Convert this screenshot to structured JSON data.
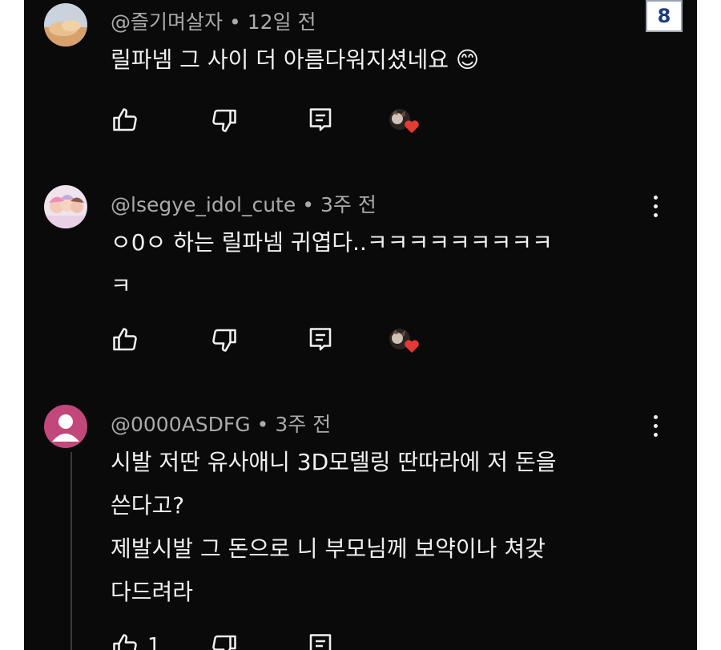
{
  "page_badge": "8",
  "comments": [
    {
      "handle": "@즐기며살자",
      "time": "12일 전",
      "lines": [
        "릴파넴 그 사이 더 아름다워지셨네요 😊"
      ],
      "like_count": ""
    },
    {
      "handle": "@lsegye_idol_cute",
      "time": "3주 전",
      "lines": [
        "ㅇ0ㅇ 하는 릴파넴 귀엽다..ㅋㅋㅋㅋㅋㅋㅋㅋㅋ",
        "ㅋ"
      ],
      "like_count": ""
    },
    {
      "handle": "@0000ASDFG",
      "time": "3주 전",
      "lines": [
        "시발 저딴 유사애니 3D모델링 딴따라에 저 돈을",
        "쓴다고?",
        "제발시발 그 돈으로 니 부모님께 보약이나 쳐갖",
        "다드려라"
      ],
      "like_count": "1"
    }
  ],
  "separator": "•",
  "icons": [
    "like-icon",
    "dislike-icon",
    "reply-icon",
    "creator-heart-icon",
    "more-options-icon"
  ],
  "colors": {
    "background": "#0a0a0a",
    "text": "#f1f1f1",
    "meta": "#aaaaaa",
    "heart": "#e53935"
  }
}
